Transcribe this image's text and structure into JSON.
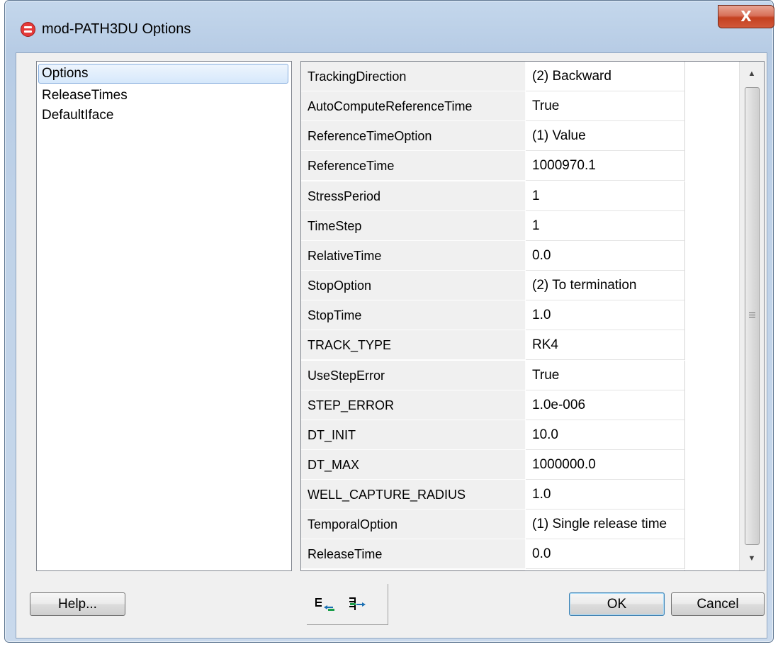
{
  "window": {
    "title": "mod-PATH3DU Options",
    "close_glyph": "X"
  },
  "tree": {
    "items": [
      {
        "label": "Options",
        "selected": true
      },
      {
        "label": "ReleaseTimes",
        "selected": false
      },
      {
        "label": "DefaultIface",
        "selected": false
      }
    ]
  },
  "properties": [
    {
      "name": "TrackingDirection",
      "value": "(2) Backward"
    },
    {
      "name": "AutoComputeReferenceTime",
      "value": "True"
    },
    {
      "name": "ReferenceTimeOption",
      "value": "(1) Value"
    },
    {
      "name": "ReferenceTime",
      "value": "1000970.1"
    },
    {
      "name": "StressPeriod",
      "value": "1"
    },
    {
      "name": "TimeStep",
      "value": "1"
    },
    {
      "name": "RelativeTime",
      "value": "0.0"
    },
    {
      "name": "StopOption",
      "value": "(2) To termination"
    },
    {
      "name": "StopTime",
      "value": "1.0"
    },
    {
      "name": "TRACK_TYPE",
      "value": "RK4"
    },
    {
      "name": "UseStepError",
      "value": "True"
    },
    {
      "name": "STEP_ERROR",
      "value": "1.0e-006"
    },
    {
      "name": "DT_INIT",
      "value": "10.0"
    },
    {
      "name": "DT_MAX",
      "value": "1000000.0"
    },
    {
      "name": "WELL_CAPTURE_RADIUS",
      "value": "1.0"
    },
    {
      "name": "TemporalOption",
      "value": "(1) Single release time"
    },
    {
      "name": "ReleaseTime",
      "value": "0.0"
    }
  ],
  "buttons": {
    "help": "Help...",
    "ok": "OK",
    "cancel": "Cancel"
  },
  "toolbar": {
    "icons": [
      "collapse-to-left-icon",
      "expand-to-right-icon"
    ]
  },
  "colors": {
    "close_button": "#c4401f",
    "selection": "#84acdd"
  }
}
